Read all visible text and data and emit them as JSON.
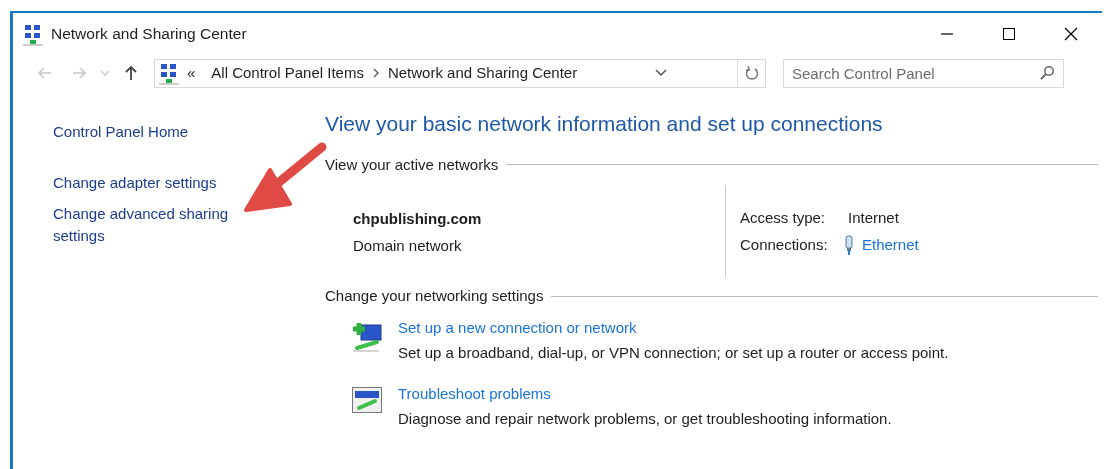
{
  "window": {
    "title": "Network and Sharing Center"
  },
  "nav_buttons": [
    {
      "kind": "back",
      "disabled": true
    },
    {
      "kind": "forward",
      "disabled": true
    },
    {
      "kind": "recent",
      "disabled": true
    },
    {
      "kind": "up",
      "disabled": false
    }
  ],
  "address": {
    "overflow": "«",
    "crumbs": [
      "All Control Panel Items",
      "Network and Sharing Center"
    ]
  },
  "search": {
    "placeholder": "Search Control Panel"
  },
  "sidebar": {
    "items": [
      {
        "label": "Control Panel Home"
      },
      {
        "label": "Change adapter settings"
      },
      {
        "label": "Change advanced sharing settings"
      }
    ]
  },
  "main": {
    "heading": "View your basic network information and set up connections",
    "active_networks": {
      "title": "View your active networks",
      "name": "chpublishing.com",
      "type": "Domain network",
      "details": [
        {
          "label": "Access type:",
          "value": "Internet",
          "kind": "text"
        },
        {
          "label": "Connections:",
          "value": "Ethernet",
          "kind": "link"
        }
      ]
    },
    "settings": {
      "title": "Change your networking settings",
      "tasks": [
        {
          "kind": "new-connection",
          "title": "Set up a new connection or network",
          "description": "Set up a broadband, dial-up, or VPN connection; or set up a router or access point."
        },
        {
          "kind": "troubleshoot",
          "title": "Troubleshoot problems",
          "description": "Diagnose and repair network problems, or get troubleshooting information."
        }
      ]
    }
  }
}
